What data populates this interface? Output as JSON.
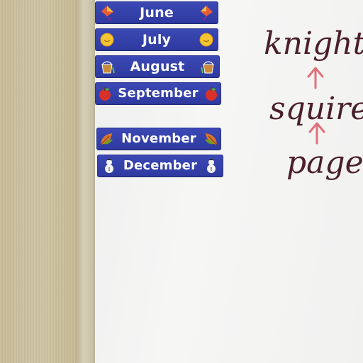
{
  "months": [
    {
      "label": "June",
      "icon": "kite-icon"
    },
    {
      "label": "July",
      "icon": "sun-icon"
    },
    {
      "label": "August",
      "icon": "beach-bucket-icon"
    },
    {
      "label": "September",
      "icon": "apple-icon"
    },
    {
      "label": "November",
      "icon": "leaf-icon"
    },
    {
      "label": "December",
      "icon": "snowman-icon"
    }
  ],
  "board_words": [
    "knight",
    "squire",
    "page"
  ],
  "colors": {
    "card_blue": "#3341a8",
    "card_text": "#ffffff",
    "marker": "#4a1f2a",
    "arrow": "#e0707a",
    "board": "#f3f3f2",
    "wall": "#c9bd9c"
  }
}
